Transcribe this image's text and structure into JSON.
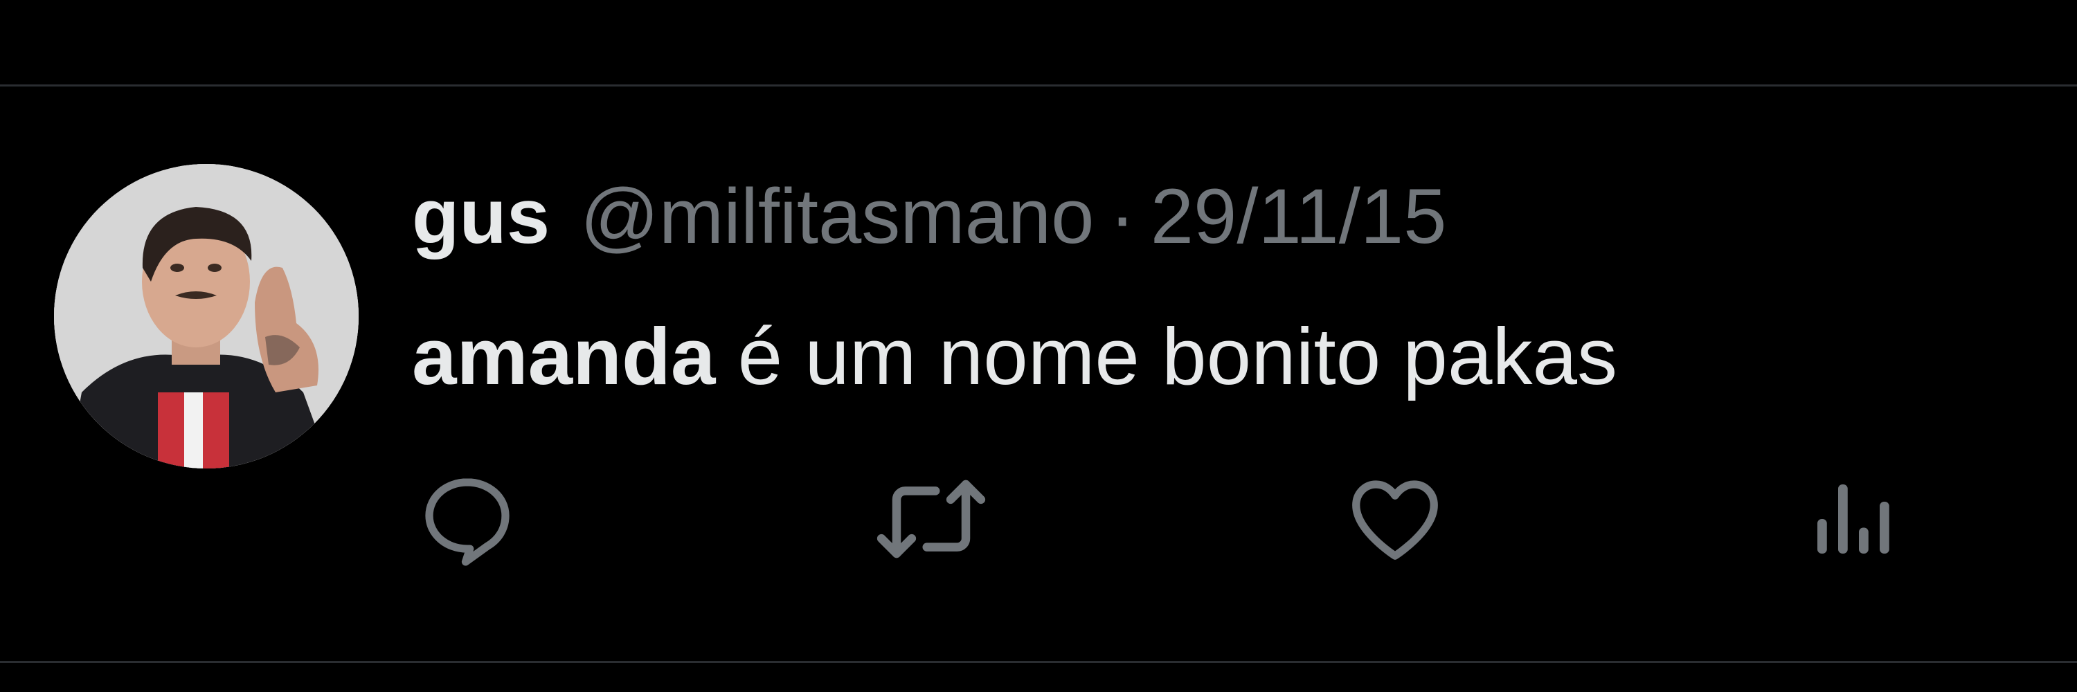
{
  "tweet": {
    "display_name": "gus",
    "handle": "@milfitasmano",
    "separator": "·",
    "date": "29/11/15",
    "text_bold": "amanda",
    "text_rest": " é um nome bonito pakas"
  },
  "actions": {
    "reply_icon": "reply-icon",
    "retweet_icon": "retweet-icon",
    "like_icon": "heart-icon",
    "views_icon": "views-icon"
  },
  "colors": {
    "background": "#000000",
    "text_primary": "#e7e9ea",
    "text_secondary": "#71767b",
    "divider": "#2a2d31"
  }
}
